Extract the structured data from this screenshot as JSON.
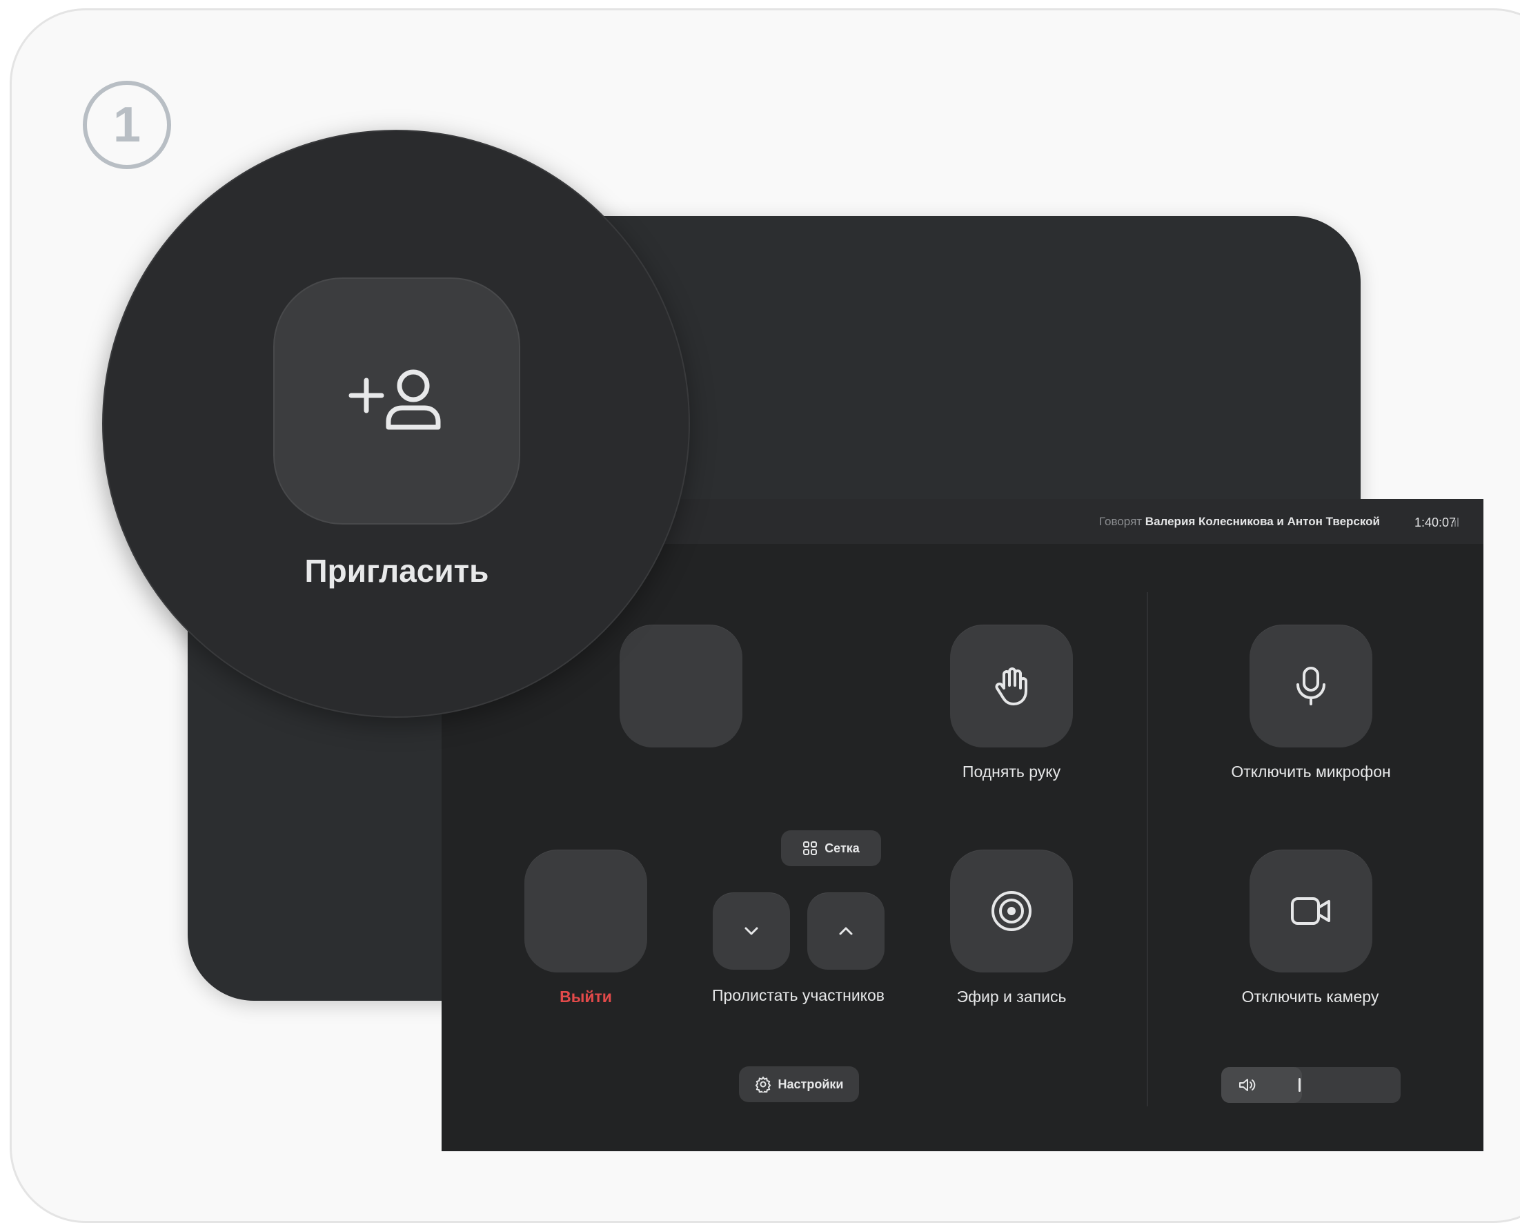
{
  "step_number": "1",
  "status_bar": {
    "speaking_prefix": "Говорят",
    "speakers": "Валерия Колесникова и Антон Тверской",
    "time": "1:40:07"
  },
  "controls": {
    "invite": {
      "label": "Пригласить",
      "icon": "add-user-icon"
    },
    "raise_hand": {
      "label": "Поднять руку",
      "icon": "hand-icon"
    },
    "mute_mic": {
      "label": "Отключить микрофон",
      "icon": "microphone-icon"
    },
    "grid": {
      "label": "Сетка",
      "icon": "grid-icon"
    },
    "scroll_participants": {
      "label": "Пролистать участников"
    },
    "broadcast_record": {
      "label": "Эфир и запись",
      "icon": "record-icon"
    },
    "camera_off": {
      "label": "Отключить камеру",
      "icon": "camera-icon"
    },
    "leave": {
      "label": "Выйти",
      "color": "#e34a4a"
    },
    "settings": {
      "label": "Настройки",
      "icon": "gear-icon"
    },
    "volume": {
      "icon": "speaker-icon",
      "level": 0.5
    }
  }
}
